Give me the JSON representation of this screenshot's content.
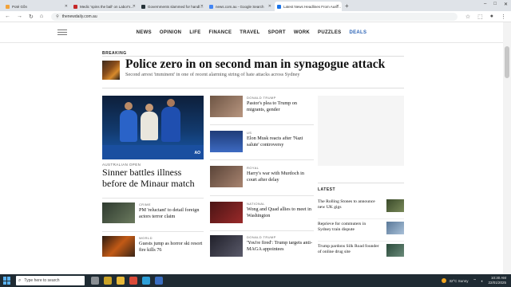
{
  "browser": {
    "tabs": [
      {
        "label": "Poté Gồn",
        "favicon": "#f2a33a",
        "active": false
      },
      {
        "label": "Medic 'spins the ball' on Labor's…",
        "favicon": "#c62828",
        "active": false
      },
      {
        "label": "Governments slammed for handl…",
        "favicon": "#263238",
        "active": false
      },
      {
        "label": "news.com.au - Google Search",
        "favicon": "#4285f4",
        "active": false
      },
      {
        "label": "Latest News Headlines From Aust…",
        "favicon": "#1a73e8",
        "active": true
      }
    ],
    "new_tab_label": "+",
    "url": "thenewdaily.com.au",
    "window_controls": [
      "–",
      "□",
      "✕"
    ]
  },
  "site_nav": {
    "items": [
      "NEWS",
      "OPINION",
      "LIFE",
      "FINANCE",
      "TRAVEL",
      "SPORT",
      "WORK",
      "PUZZLES",
      "DEALS"
    ]
  },
  "breaking": {
    "label": "BREAKING",
    "title": "Police zero in on second man in synagogue attack",
    "subtitle": "Second arrest 'imminent' in one of recent alarming string of hate attacks across Sydney"
  },
  "lead": {
    "category": "AUSTRALIAN OPEN",
    "title": "Sinner battles illness before de Minaur match",
    "image_sign": "AO"
  },
  "left_stories": [
    {
      "category": "CRIME",
      "title": "PM 'reluctant' to detail foreign actors terror claim",
      "thumb": "#3b4a3c"
    },
    {
      "category": "WORLD",
      "title": "Guests jump as horror ski resort fire kills 76",
      "thumb": "#7a3b14"
    }
  ],
  "mid_stories": [
    {
      "category": "DONALD TRUMP",
      "title": "Pastor's plea to Trump on migrants, gender",
      "thumb": "#8d6b55"
    },
    {
      "category": "US",
      "title": "Elon Musk reacts after 'Nazi salute' controversy",
      "thumb": "#2c4f8a"
    },
    {
      "category": "ROYAL",
      "title": "Harry's war with Murdoch in court after delay",
      "thumb": "#7b5c4a"
    },
    {
      "category": "NATIONAL",
      "title": "Wong and Quad allies to meet in Washington",
      "thumb": "#6a2020"
    },
    {
      "category": "DONALD TRUMP",
      "title": "'You're fired': Trump targets anti-MAGA appointees",
      "thumb": "#3a3a45"
    }
  ],
  "latest": {
    "label": "LATEST",
    "items": [
      {
        "title": "The Rolling Stones to announce new UK gigs",
        "thumb": "#4a5a3a"
      },
      {
        "title": "Reprieve for commuters in Sydney train dispute",
        "thumb": "#6b88a8"
      },
      {
        "title": "Trump pardons Silk Road founder of online drug site",
        "thumb": "#3d5a4a"
      }
    ]
  },
  "taskbar": {
    "search_placeholder": "Type here to search",
    "weather": "32°C Sunny",
    "time": "10:30 AM",
    "date": "22/01/2025"
  }
}
